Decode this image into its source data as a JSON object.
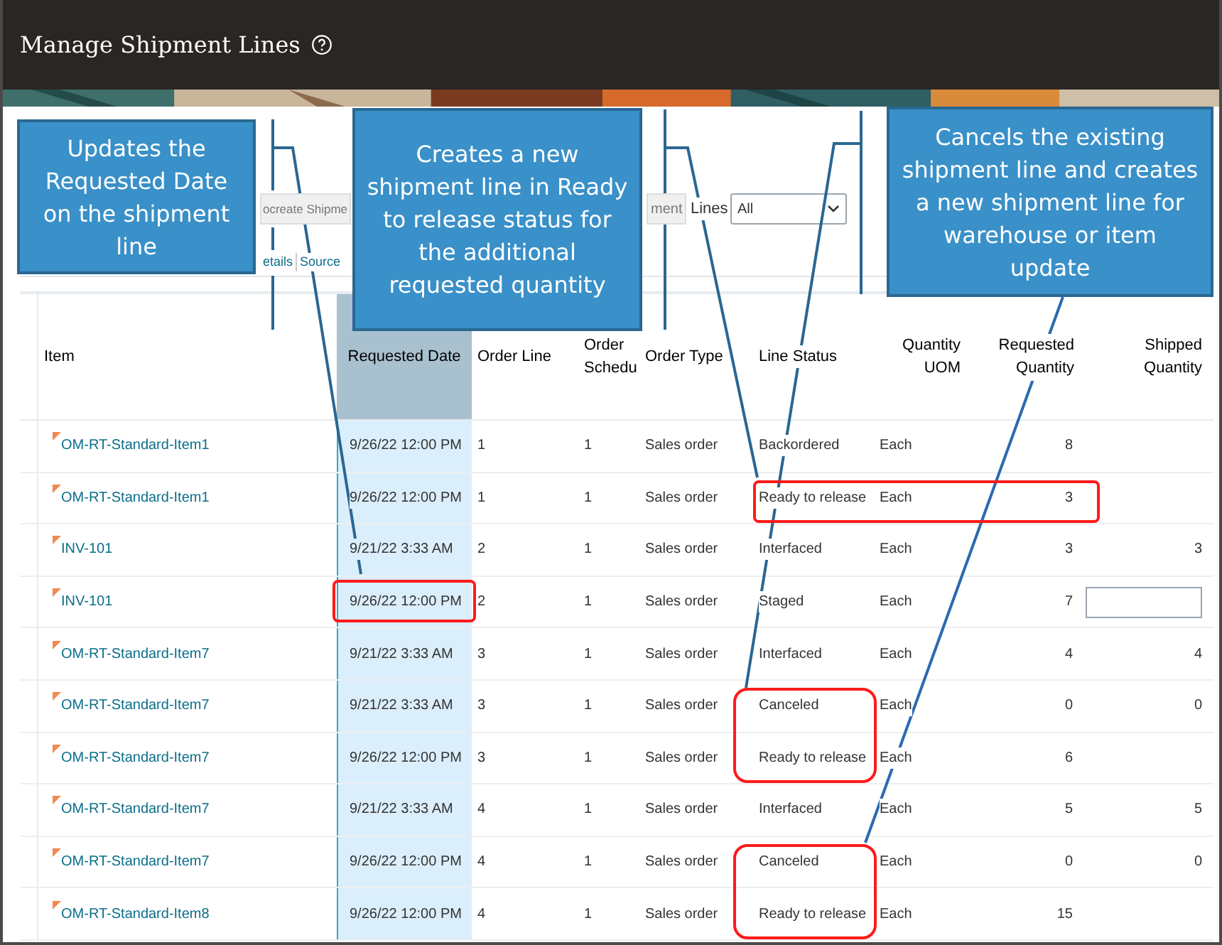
{
  "window": {
    "title": "Manage Shipment Lines"
  },
  "toolbar": {
    "buttons": [
      "ocreate Shipme",
      "ment"
    ],
    "lines_label": "Lines",
    "lines_select": "All"
  },
  "tabs": [
    {
      "label": "etails",
      "selected": false
    },
    {
      "label": "Source",
      "selected": false
    }
  ],
  "table": {
    "columns": [
      "Item",
      "Requested Date",
      "Order Line",
      "Order Schedu",
      "Order Type",
      "Line Status",
      "Quantity UOM",
      "Requested Quantity",
      "Shipped Quantity"
    ],
    "rows": [
      {
        "item": "OM-RT-Standard-Item1",
        "date": "9/26/22 12:00 PM",
        "line": "1",
        "schedule": "1",
        "type": "Sales order",
        "status": "Backordered",
        "uom": "Each",
        "requested": "8",
        "kind": "text",
        "shipped": ""
      },
      {
        "item": "OM-RT-Standard-Item1",
        "date": "9/26/22 12:00 PM",
        "line": "1",
        "schedule": "1",
        "type": "Sales order",
        "status": "Ready to release",
        "uom": "Each",
        "requested": "3",
        "kind": "text",
        "shipped": ""
      },
      {
        "item": "INV-101",
        "date": "9/21/22 3:33 AM",
        "line": "2",
        "schedule": "1",
        "type": "Sales order",
        "status": "Interfaced",
        "uom": "Each",
        "requested": "3",
        "kind": "text",
        "shipped": "3"
      },
      {
        "item": "INV-101",
        "date": "9/26/22 12:00 PM",
        "line": "2",
        "schedule": "1",
        "type": "Sales order",
        "status": "Staged",
        "uom": "Each",
        "requested": "7",
        "kind": "input",
        "shipped": ""
      },
      {
        "item": "OM-RT-Standard-Item7",
        "date": "9/21/22 3:33 AM",
        "line": "3",
        "schedule": "1",
        "type": "Sales order",
        "status": "Interfaced",
        "uom": "Each",
        "requested": "4",
        "kind": "text",
        "shipped": "4"
      },
      {
        "item": "OM-RT-Standard-Item7",
        "date": "9/21/22 3:33 AM",
        "line": "3",
        "schedule": "1",
        "type": "Sales order",
        "status": "Canceled",
        "uom": "Each",
        "requested": "0",
        "kind": "text",
        "shipped": "0"
      },
      {
        "item": "OM-RT-Standard-Item7",
        "date": "9/26/22 12:00 PM",
        "line": "3",
        "schedule": "1",
        "type": "Sales order",
        "status": "Ready to release",
        "uom": "Each",
        "requested": "6",
        "kind": "text",
        "shipped": ""
      },
      {
        "item": "OM-RT-Standard-Item7",
        "date": "9/21/22 3:33 AM",
        "line": "4",
        "schedule": "1",
        "type": "Sales order",
        "status": "Interfaced",
        "uom": "Each",
        "requested": "5",
        "kind": "text",
        "shipped": "5"
      },
      {
        "item": "OM-RT-Standard-Item7",
        "date": "9/26/22 12:00 PM",
        "line": "4",
        "schedule": "1",
        "type": "Sales order",
        "status": "Canceled",
        "uom": "Each",
        "requested": "0",
        "kind": "text",
        "shipped": "0"
      },
      {
        "item": "OM-RT-Standard-Item8",
        "date": "9/26/22 12:00 PM",
        "line": "4",
        "schedule": "1",
        "type": "Sales order",
        "status": "Ready to release",
        "uom": "Each",
        "requested": "15",
        "kind": "text",
        "shipped": ""
      }
    ]
  },
  "callouts": [
    "Updates the Requested  Date on the shipment line",
    "Creates a new shipment line in Ready to release status for the additional requested quantity",
    "Cancels the existing shipment line and creates a new shipment line for warehouse or item update"
  ]
}
